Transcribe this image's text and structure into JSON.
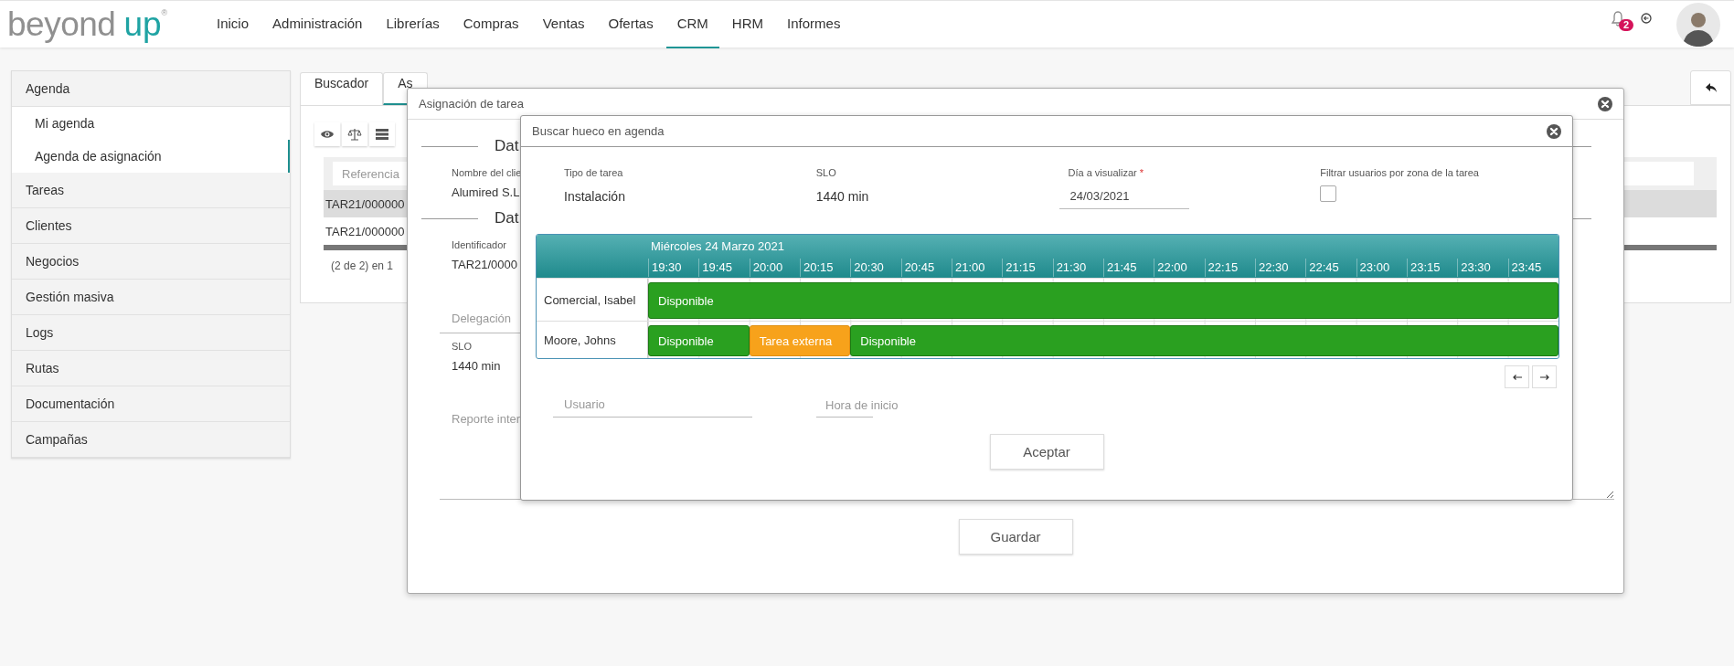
{
  "header": {
    "logo": {
      "word1": "beyond",
      "word2": "up",
      "mark": "®"
    },
    "nav": [
      {
        "label": "Inicio",
        "selected": false
      },
      {
        "label": "Administración",
        "selected": false
      },
      {
        "label": "Librerías",
        "selected": false
      },
      {
        "label": "Compras",
        "selected": false
      },
      {
        "label": "Ventas",
        "selected": false
      },
      {
        "label": "Ofertas",
        "selected": false
      },
      {
        "label": "CRM",
        "selected": true
      },
      {
        "label": "HRM",
        "selected": false
      },
      {
        "label": "Informes",
        "selected": false
      }
    ],
    "notifications": {
      "count": "2"
    }
  },
  "sidebar": {
    "items": [
      {
        "label": "Agenda",
        "children": [
          {
            "label": "Mi agenda",
            "selected": false
          },
          {
            "label": "Agenda de asignación",
            "selected": true
          }
        ]
      },
      {
        "label": "Tareas"
      },
      {
        "label": "Clientes"
      },
      {
        "label": "Negocios"
      },
      {
        "label": "Gestión masiva"
      },
      {
        "label": "Logs"
      },
      {
        "label": "Rutas"
      },
      {
        "label": "Documentación"
      },
      {
        "label": "Campañas"
      }
    ]
  },
  "content": {
    "tabs": [
      {
        "label": "Buscador",
        "selected": false
      },
      {
        "label": "As",
        "selected": true
      }
    ],
    "table": {
      "filter_placeholder": "Referencia",
      "rows": [
        {
          "cells": [
            "TAR21/000000"
          ],
          "selected": true
        },
        {
          "cells": [
            "TAR21/000000"
          ],
          "selected": false
        }
      ],
      "pagination": "(2 de 2) en 1"
    }
  },
  "task_dialog": {
    "title": "Asignación de tarea",
    "sections": [
      {
        "heading": "Dat",
        "fields": [
          {
            "label": "Nombre del clie",
            "value": "Alumired S.L"
          }
        ]
      },
      {
        "heading": "Dat",
        "fields": [
          {
            "label": "Identificador",
            "value": "TAR21/0000"
          }
        ]
      }
    ],
    "delegation_placeholder": "Delegación",
    "slo": {
      "label": "SLO",
      "value": "1440 min"
    },
    "report_placeholder": "Reporte inter",
    "save_button": "Guardar"
  },
  "slot_dialog": {
    "title": "Buscar hueco en agenda",
    "fields": [
      {
        "kind": "text",
        "label": "Tipo de tarea",
        "value": "Instalación"
      },
      {
        "kind": "text",
        "label": "SLO",
        "value": "1440 min"
      },
      {
        "kind": "date",
        "label": "Día a visualizar",
        "required_mark": "*",
        "value": "24/03/2021"
      },
      {
        "kind": "checkbox",
        "label": "Filtrar usuarios por zona de la tarea",
        "checked": false
      }
    ],
    "timeline": {
      "date": "Miércoles 24 Marzo 2021",
      "slots": [
        "19:30",
        "19:45",
        "20:00",
        "20:15",
        "20:30",
        "20:45",
        "21:00",
        "21:15",
        "21:30",
        "21:45",
        "22:00",
        "22:15",
        "22:30",
        "22:45",
        "23:00",
        "23:15",
        "23:30",
        "23:45"
      ],
      "rows": [
        {
          "name": "Comercial, Isabel",
          "blocks": [
            {
              "kind": "available",
              "label": "Disponible",
              "level": 1
            }
          ]
        },
        {
          "name": "Moore, Johns",
          "blocks": [
            {
              "kind": "available",
              "label": "Disponible",
              "level": 0.1111
            },
            {
              "kind": "external",
              "label": "Tarea externa",
              "level": 0.1111
            },
            {
              "kind": "available",
              "label": "Disponible",
              "level": 0.7778
            }
          ]
        }
      ]
    },
    "user_placeholder": "Usuario",
    "start_placeholder": "Hora de inicio",
    "accept_button": "Aceptar"
  }
}
